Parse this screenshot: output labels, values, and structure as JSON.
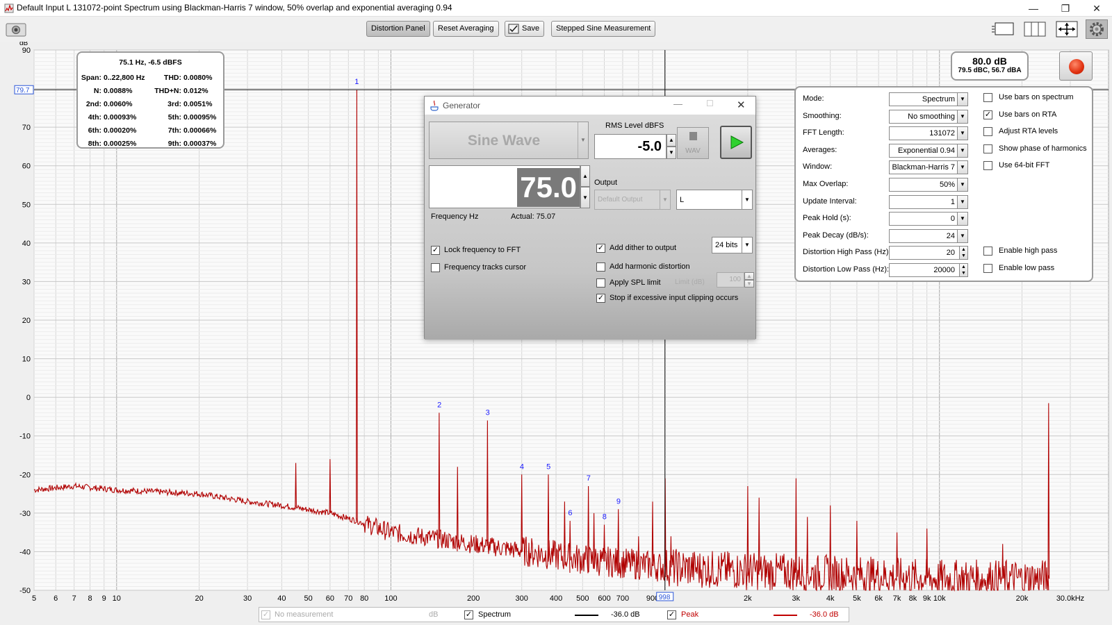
{
  "window": {
    "title": "Default Input L 131072-point Spectrum using Blackman-Harris 7 window, 50% overlap and exponential averaging 0.94"
  },
  "toolbar": {
    "distortion_panel": "Distortion Panel",
    "reset_averaging": "Reset Averaging",
    "save": "Save",
    "stepped_sine": "Stepped Sine Measurement"
  },
  "graph": {
    "y_unit": "dB",
    "cursor_y_value": "79.7",
    "cursor_x_value": "998",
    "x_unit": "30.0kHz",
    "harmonic_markers": [
      "1",
      "2",
      "3",
      "4",
      "5",
      "6",
      "7",
      "8",
      "9"
    ]
  },
  "distortion": {
    "header": "75.1 Hz, -6.5 dBFS",
    "rows": [
      {
        "l_key": "Span:",
        "l_val": "0..22,800 Hz",
        "r_key": "THD:",
        "r_val": "0.0080%"
      },
      {
        "l_key": "N:",
        "l_val": "0.0088%",
        "r_key": "THD+N:",
        "r_val": "0.012%"
      },
      {
        "l_key": "2nd:",
        "l_val": "0.0060%",
        "r_key": "3rd:",
        "r_val": "0.0051%"
      },
      {
        "l_key": "4th:",
        "l_val": "0.00093%",
        "r_key": "5th:",
        "r_val": "0.00095%"
      },
      {
        "l_key": "6th:",
        "l_val": "0.00020%",
        "r_key": "7th:",
        "r_val": "0.00066%"
      },
      {
        "l_key": "8th:",
        "l_val": "0.00025%",
        "r_key": "9th:",
        "r_val": "0.00037%"
      }
    ]
  },
  "level": {
    "main": "80.0 dB",
    "sub": "79.5 dBC, 56.7 dBA"
  },
  "controls": {
    "rows": [
      {
        "label": "Mode:",
        "value": "Spectrum"
      },
      {
        "label": "Smoothing:",
        "value": "No  smoothing"
      },
      {
        "label": "FFT Length:",
        "value": "131072"
      },
      {
        "label": "Averages:",
        "value": "Exponential 0.94"
      },
      {
        "label": "Window:",
        "value": "Blackman-Harris 7"
      },
      {
        "label": "Max Overlap:",
        "value": "50%"
      },
      {
        "label": "Update Interval:",
        "value": "1"
      },
      {
        "label": "Peak Hold (s):",
        "value": "0"
      },
      {
        "label": "Peak Decay (dB/s):",
        "value": "24"
      },
      {
        "label": "Distortion High Pass (Hz):",
        "value": "20"
      },
      {
        "label": "Distortion Low Pass (Hz):",
        "value": "20000"
      }
    ],
    "checks": [
      {
        "label": "Use bars on spectrum",
        "checked": false
      },
      {
        "label": "Use bars on RTA",
        "checked": true
      },
      {
        "label": "Adjust RTA levels",
        "checked": false
      },
      {
        "label": "Show phase of harmonics",
        "checked": false
      },
      {
        "label": "Use 64-bit FFT",
        "checked": false
      }
    ],
    "enable_high_pass": "Enable high pass",
    "enable_low_pass": "Enable low pass"
  },
  "generator": {
    "title": "Generator",
    "waveform": "Sine Wave",
    "rms_label": "RMS Level dBFS",
    "rms_value": "-5.0",
    "wav_label": "WAV",
    "frequency_value": "75.0",
    "frequency_label": "Frequency Hz",
    "actual": "Actual: 75.07",
    "output_label": "Output",
    "output_device": "Default Output",
    "channel": "L",
    "lock_frequency": "Lock frequency to FFT",
    "tracks_cursor": "Frequency tracks cursor",
    "add_dither": "Add dither to output",
    "bits": "24 bits",
    "add_harmonic": "Add harmonic distortion",
    "apply_spl": "Apply SPL limit",
    "limit_label": "Limit (dB)",
    "limit_value": "100",
    "stop_clipping": "Stop if excessive input clipping occurs"
  },
  "legend": {
    "no_measurement": "No measurement",
    "no_measurement_unit": "dB",
    "spectrum": "Spectrum",
    "spectrum_value": "-36.0 dB",
    "peak": "Peak",
    "peak_value": "-36.0 dB"
  },
  "colors": {
    "trace": "#b00000",
    "marker": "#1a1aff",
    "grid": "#c8c8c8"
  },
  "chart_data": {
    "type": "line",
    "xscale": "log",
    "xlim": [
      5,
      30000
    ],
    "ylim": [
      -50,
      90
    ],
    "ylabel": "dB",
    "x_ticks": [
      "5",
      "6",
      "7",
      "8",
      "9",
      "10",
      "20",
      "30",
      "40",
      "50",
      "60",
      "70",
      "80",
      "100",
      "200",
      "300",
      "400",
      "500",
      "600",
      "700",
      "900",
      "2k",
      "3k",
      "4k",
      "5k",
      "6k",
      "7k",
      "8k",
      "9k",
      "10k",
      "20k",
      "30.0kHz"
    ],
    "y_ticks": [
      90,
      80,
      70,
      60,
      50,
      40,
      30,
      20,
      10,
      0,
      -10,
      -20,
      -30,
      -40,
      -50
    ],
    "series": [
      {
        "name": "Peak",
        "noise_floor": [
          [
            5,
            -24
          ],
          [
            7,
            -23
          ],
          [
            10,
            -24
          ],
          [
            20,
            -25
          ],
          [
            30,
            -27
          ],
          [
            40,
            -28
          ],
          [
            60,
            -30
          ],
          [
            75,
            -32
          ],
          [
            100,
            -35
          ],
          [
            200,
            -38
          ],
          [
            500,
            -42
          ],
          [
            1000,
            -44
          ],
          [
            2000,
            -45
          ],
          [
            5000,
            -46
          ],
          [
            10000,
            -47
          ],
          [
            20000,
            -47
          ],
          [
            25000,
            -47
          ]
        ],
        "peaks": [
          [
            45,
            -17
          ],
          [
            60,
            -16
          ],
          [
            75.1,
            79.7
          ],
          [
            150,
            -4
          ],
          [
            175,
            -18
          ],
          [
            225,
            -6
          ],
          [
            300,
            -20
          ],
          [
            375,
            -20
          ],
          [
            430,
            -27
          ],
          [
            450,
            -32
          ],
          [
            525,
            -23
          ],
          [
            550,
            -30
          ],
          [
            600,
            -33
          ],
          [
            675,
            -29
          ],
          [
            800,
            -36
          ],
          [
            900,
            -27
          ],
          [
            1000,
            -21
          ],
          [
            1050,
            -36
          ],
          [
            2000,
            -23
          ],
          [
            2200,
            -26
          ],
          [
            3000,
            -21
          ],
          [
            3300,
            -31
          ],
          [
            4000,
            -28
          ],
          [
            5000,
            -32
          ],
          [
            7000,
            -35
          ],
          [
            9000,
            -34
          ],
          [
            17000,
            -38
          ],
          [
            25000,
            -1.5
          ]
        ]
      }
    ]
  }
}
